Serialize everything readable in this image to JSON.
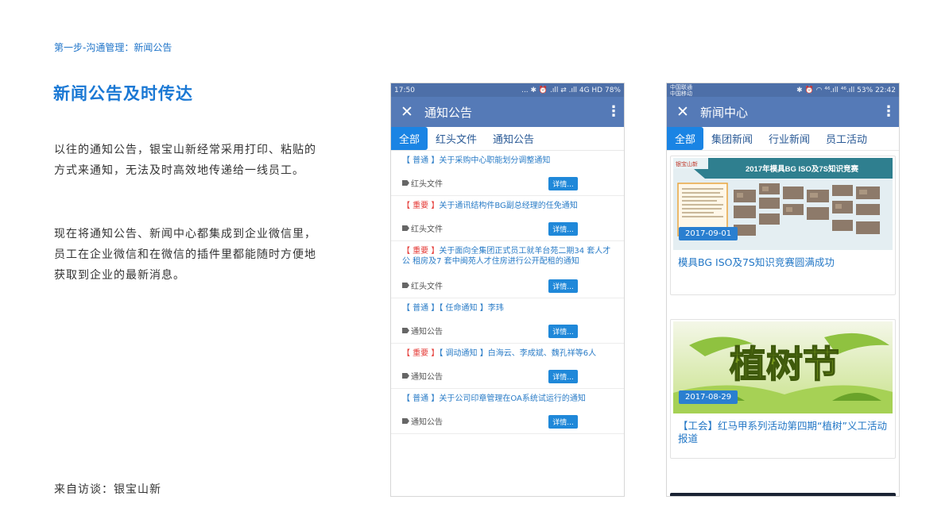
{
  "page": {
    "breadcrumb": "第一步-沟通管理：新闻公告",
    "headline": "新闻公告及时传达",
    "paragraph1": "以往的通知公告，银宝山新经常采用打印、粘贴的方式来通知，无法及时高效地传递给一线员工。",
    "paragraph2": "现在将通知公告、新闻中心都集成到企业微信里，员工在企业微信和在微信的插件里都能随时方便地获取到企业的最新消息。",
    "source": "来自访谈：银宝山新"
  },
  "colors": {
    "accent_blue": "#1a78d4",
    "app_bar": "#557ab7",
    "tab_active": "#1a84e4",
    "important_red": "#e53935"
  },
  "phone1": {
    "status": {
      "time": "17:50",
      "icons": "... ✱ ⏰ .ıll ⇄ .ıll 4G HD",
      "battery": "78%"
    },
    "title": "通知公告",
    "tabs": [
      "全部",
      "红头文件",
      "通知公告"
    ],
    "detail_label": "详情...",
    "notices": [
      {
        "level": "【 普通 】",
        "text": "关于采购中心职能划分调整通知",
        "tag": "红头文件"
      },
      {
        "level": "【 重要 】",
        "text": "关于通讯结构件BG副总经理的任免通知",
        "tag": "红头文件"
      },
      {
        "level": "【 重要 】",
        "text": "关于面向全集团正式员工就羊台苑二期34 套人才公 租房及7 套中闽苑人才住房进行公开配租的通知",
        "tag": "红头文件"
      },
      {
        "level": "【 普通 】",
        "text": "【 任命通知 】李玮",
        "tag": "通知公告"
      },
      {
        "level": "【 重要 】",
        "text": "【 调动通知 】白海云、李成斌、魏孔祥等6人",
        "tag": "通知公告"
      },
      {
        "level": "【 普通 】",
        "text": "关于公司印章管理在OA系统试运行的通知",
        "tag": "通知公告"
      }
    ]
  },
  "phone2": {
    "status": {
      "carrier_line1": "中国联通",
      "carrier_line2": "中国移动",
      "icons": "✱ ⏰ ◠ ⁴⁶.ıll ⁴⁶.ıll",
      "battery": "53%",
      "time": "22:42"
    },
    "title": "新闻中心",
    "tabs": [
      "全部",
      "集团新闻",
      "行业新闻",
      "员工活动"
    ],
    "cards": [
      {
        "banner_text": "2017年模具BG ISO及7S知识竞赛",
        "logo_text": "银宝山新",
        "date": "2017-09-01",
        "title": "模具BG ISO及7S知识竞赛圆满成功"
      },
      {
        "banner_text": "植树节",
        "date": "2017-08-29",
        "title": "【工会】红马甲系列活动第四期“植树”义工活动报道"
      }
    ]
  }
}
